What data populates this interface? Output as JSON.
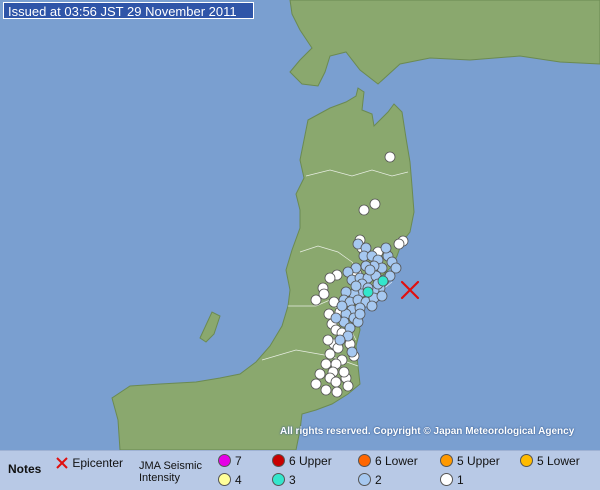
{
  "header": {
    "issued": "Issued at 03:56 JST  29 November 2011"
  },
  "credit": "All rights reserved. Copyright © Japan Meteorological Agency",
  "legend": {
    "notes": "Notes",
    "epicenter": "Epicenter",
    "scale_line1": "JMA Seismic",
    "scale_line2": "Intensity",
    "levels": [
      {
        "label": "7",
        "color": "#e600e6"
      },
      {
        "label": "6 Upper",
        "color": "#c80000"
      },
      {
        "label": "6 Lower",
        "color": "#ff6600"
      },
      {
        "label": "5 Upper",
        "color": "#ff9900"
      },
      {
        "label": "5 Lower",
        "color": "#ffbb00"
      },
      {
        "label": "4",
        "color": "#ffff99"
      },
      {
        "label": "3",
        "color": "#33e6cc"
      },
      {
        "label": "2",
        "color": "#a6c8f0"
      },
      {
        "label": "1",
        "color": "#ffffff"
      }
    ]
  },
  "colors": {
    "sea": "#7a9fd0",
    "land": "#8aa86e",
    "epicenter": "#e01010"
  },
  "map": {
    "epicenter_marker": "x-mark",
    "stations": {
      "intensity_3": 2,
      "intensity_2": 50,
      "intensity_1": 40
    }
  }
}
